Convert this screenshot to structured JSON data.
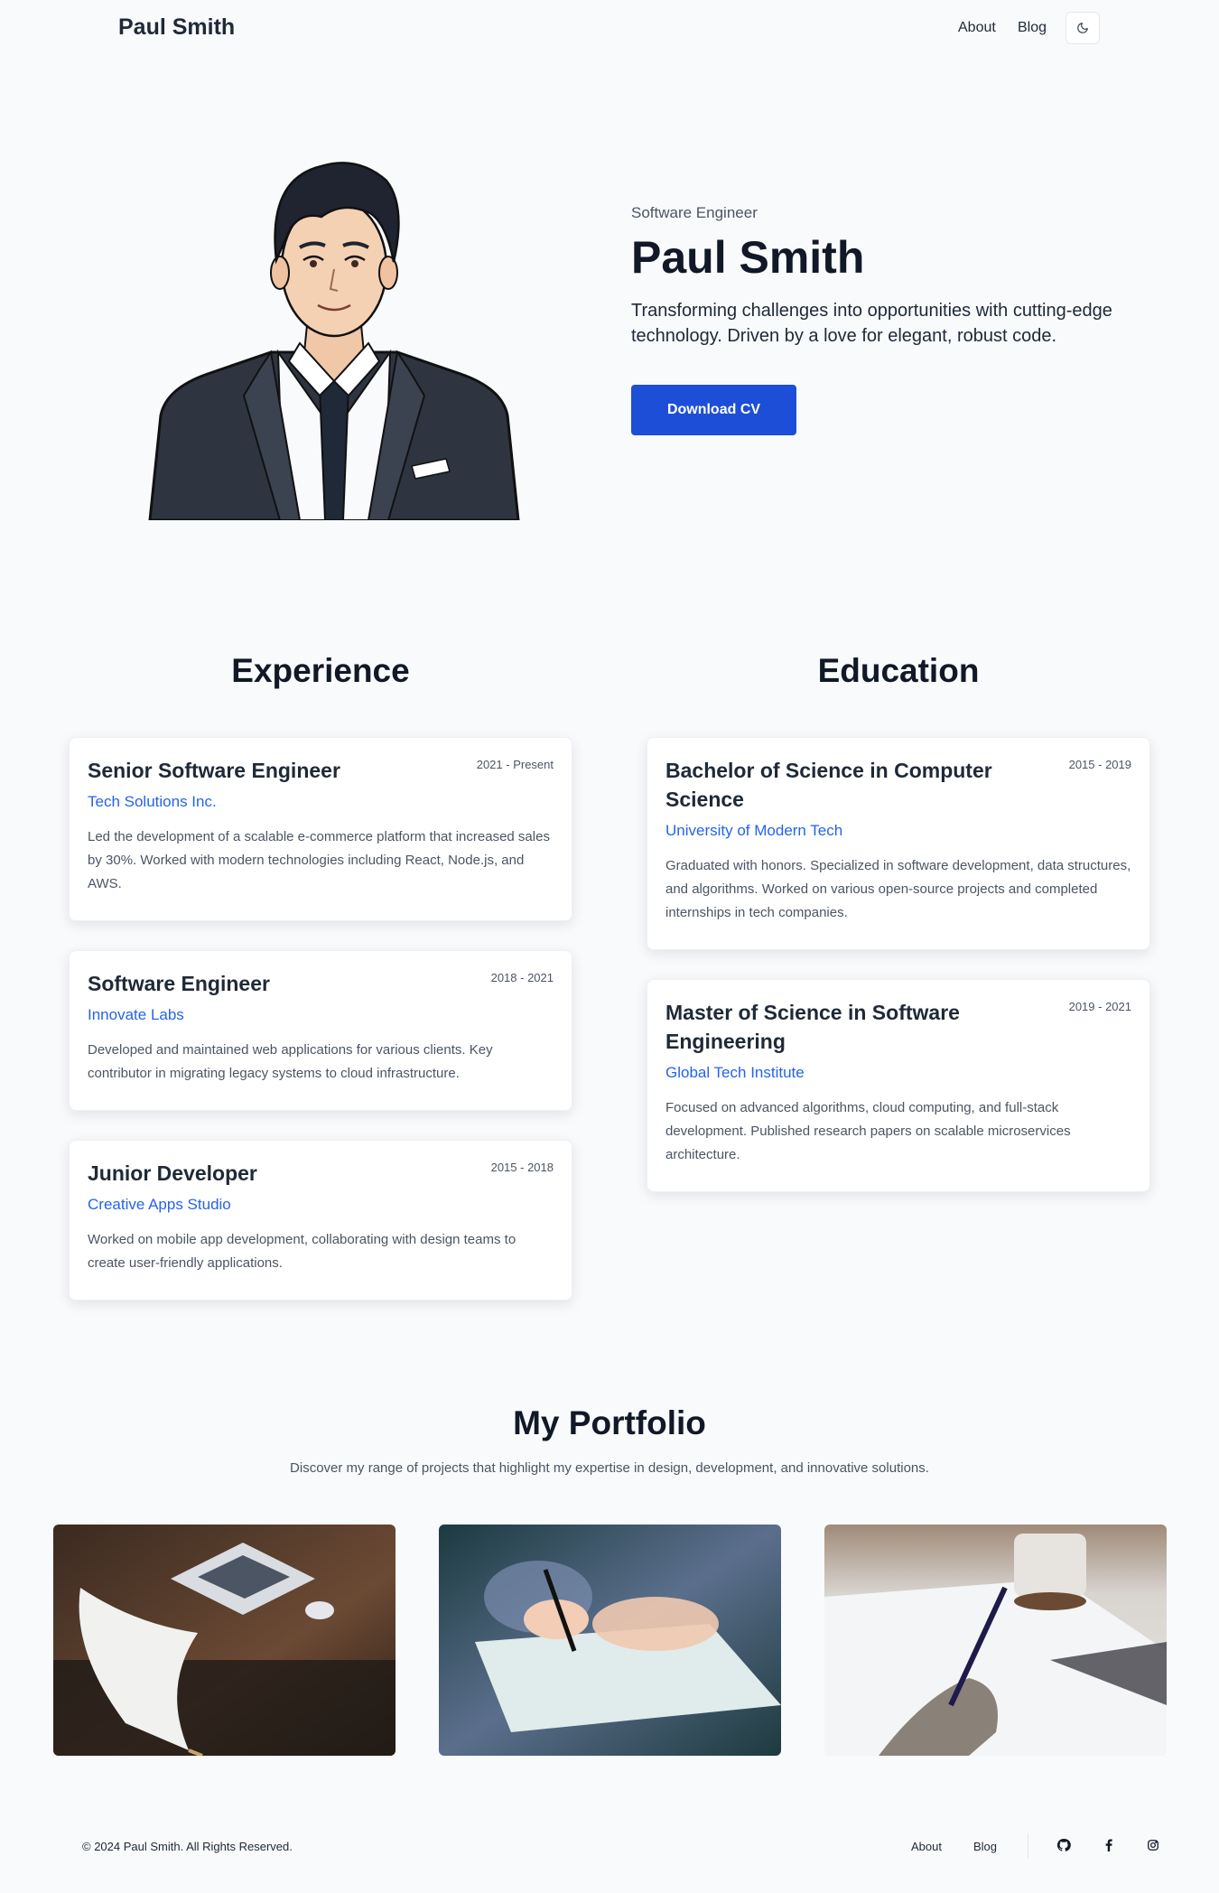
{
  "header": {
    "brand": "Paul Smith",
    "nav": [
      {
        "label": "About"
      },
      {
        "label": "Blog"
      }
    ],
    "theme_toggle_icon": "moon-icon"
  },
  "hero": {
    "subtitle": "Software Engineer",
    "title": "Paul Smith",
    "description": "Transforming challenges into opportunities with cutting-edge technology. Driven by a love for elegant, robust code.",
    "cta_label": "Download CV",
    "cta_color": "#1d4ed8"
  },
  "experience": {
    "title": "Experience",
    "items": [
      {
        "title": "Senior Software Engineer",
        "date": "2021 - Present",
        "org": "Tech Solutions Inc.",
        "desc": "Led the development of a scalable e-commerce platform that increased sales by 30%. Worked with modern technologies including React, Node.js, and AWS."
      },
      {
        "title": "Software Engineer",
        "date": "2018 - 2021",
        "org": "Innovate Labs",
        "desc": "Developed and maintained web applications for various clients. Key contributor in migrating legacy systems to cloud infrastructure."
      },
      {
        "title": "Junior Developer",
        "date": "2015 - 2018",
        "org": "Creative Apps Studio",
        "desc": "Worked on mobile app development, collaborating with design teams to create user-friendly applications."
      }
    ]
  },
  "education": {
    "title": "Education",
    "items": [
      {
        "title": "Bachelor of Science in Computer Science",
        "date": "2015 - 2019",
        "org": "University of Modern Tech",
        "desc": "Graduated with honors. Specialized in software development, data structures, and algorithms. Worked on various open-source projects and completed internships in tech companies."
      },
      {
        "title": "Master of Science in Software Engineering",
        "date": "2019 - 2021",
        "org": "Global Tech Institute",
        "desc": "Focused on advanced algorithms, cloud computing, and full-stack development. Published research papers on scalable microservices architecture."
      }
    ]
  },
  "portfolio": {
    "title": "My Portfolio",
    "subtitle": "Discover my range of projects that highlight my expertise in design, development, and innovative solutions."
  },
  "footer": {
    "copyright": "© 2024 Paul Smith. All Rights Reserved.",
    "links": [
      {
        "label": "About"
      },
      {
        "label": "Blog"
      }
    ],
    "social_icons": [
      "github-icon",
      "facebook-icon",
      "instagram-icon"
    ]
  },
  "colors": {
    "accent": "#1d4ed8",
    "org_link": "#2563eb",
    "background": "#f8fafc"
  }
}
